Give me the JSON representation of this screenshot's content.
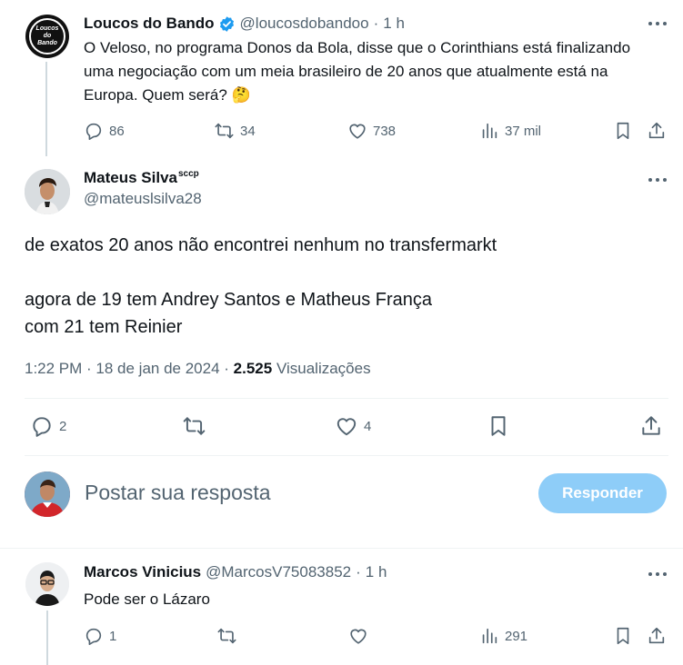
{
  "tweet1": {
    "name": "Loucos do Bando",
    "handle": "@loucosdobandoo",
    "separator": "·",
    "time": "1 h",
    "text": "O Veloso, no programa Donos da Bola, disse que o Corinthians está finalizando uma negociação com um meia brasileiro de 20 anos que atualmente está na Europa. Quem será? 🤔",
    "replies": "86",
    "retweets": "34",
    "likes": "738",
    "views": "37 mil",
    "avatar_text": "Loucos do Bando"
  },
  "main_tweet": {
    "name": "Mateus Silva",
    "name_suffix": "sccp",
    "handle": "@mateuslsilva28",
    "line1": "de exatos 20 anos não encontrei nenhum no transfermarkt",
    "line2": "agora de 19 tem Andrey Santos e Matheus França",
    "line3": "com 21 tem Reinier",
    "timestamp": "1:22 PM · 18 de jan de 2024 ·",
    "views_count": "2.525",
    "views_label": "Visualizações",
    "replies": "2",
    "retweets": "",
    "likes": "4"
  },
  "compose": {
    "placeholder": "Postar sua resposta",
    "button": "Responder"
  },
  "reply": {
    "name": "Marcos Vinicius",
    "handle": "@MarcosV75083852",
    "separator": "·",
    "time": "1 h",
    "text": "Pode ser o Lázaro",
    "replies": "1",
    "retweets": "",
    "likes": "",
    "views": "291"
  },
  "colors": {
    "accent": "#1d9bf0",
    "button_disabled": "#8ecdf8",
    "text_secondary": "#536471"
  },
  "icons": [
    "more-icon",
    "verified-icon",
    "reply-icon",
    "retweet-icon",
    "like-icon",
    "views-icon",
    "bookmark-icon",
    "share-icon"
  ]
}
